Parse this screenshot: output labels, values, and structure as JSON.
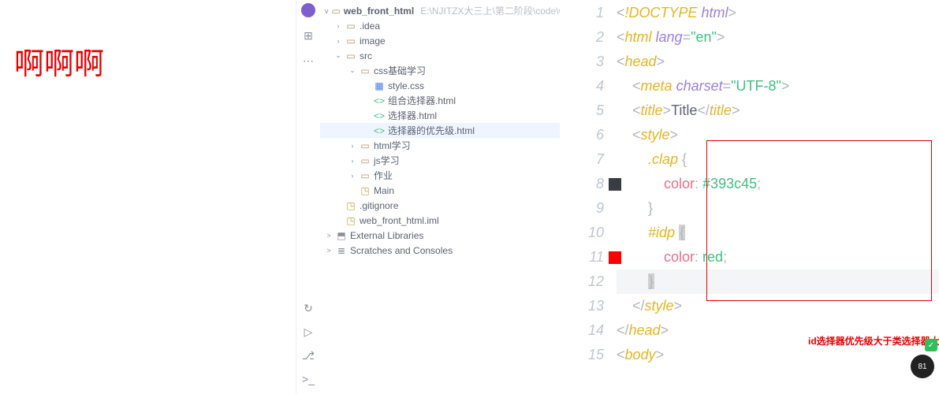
{
  "page_render": {
    "text": "啊啊啊"
  },
  "toolstrip": {
    "top": [
      "avatar",
      "structure-icon",
      "more-icon"
    ],
    "bottom": [
      "history-icon",
      "run-icon",
      "git-icon",
      "terminal-icon"
    ]
  },
  "project": {
    "root_name": "web_front_html",
    "root_path": "E:\\NJITZX大三上\\第二阶段\\code\\web_front_html",
    "items": [
      {
        "depth": 1,
        "chev": ">",
        "icon": "folder",
        "label": ".idea"
      },
      {
        "depth": 1,
        "chev": ">",
        "icon": "folder",
        "label": "image"
      },
      {
        "depth": 1,
        "chev": "v",
        "icon": "folder",
        "label": "src"
      },
      {
        "depth": 2,
        "chev": "v",
        "icon": "folder",
        "label": "css基础学习"
      },
      {
        "depth": 3,
        "chev": "",
        "icon": "css",
        "label": "style.css"
      },
      {
        "depth": 3,
        "chev": "",
        "icon": "html",
        "label": "组合选择器.html"
      },
      {
        "depth": 3,
        "chev": "",
        "icon": "html",
        "label": "选择器.html"
      },
      {
        "depth": 3,
        "chev": "",
        "icon": "html",
        "label": "选择器的优先级.html",
        "selected": true
      },
      {
        "depth": 2,
        "chev": ">",
        "icon": "folder",
        "label": "html学习"
      },
      {
        "depth": 2,
        "chev": ">",
        "icon": "folder",
        "label": "js学习"
      },
      {
        "depth": 2,
        "chev": ">",
        "icon": "folder",
        "label": "作业"
      },
      {
        "depth": 2,
        "chev": "",
        "icon": "cfg",
        "label": "Main"
      },
      {
        "depth": 1,
        "chev": "",
        "icon": "cfg",
        "label": ".gitignore"
      },
      {
        "depth": 1,
        "chev": "",
        "icon": "cfg",
        "label": "web_front_html.iml"
      }
    ],
    "ext_lib": "External Libraries",
    "scratches": "Scratches and Consoles"
  },
  "editor": {
    "lines": [
      {
        "n": 1,
        "tokens": [
          [
            "<",
            "angle"
          ],
          [
            "!DOCTYPE ",
            "tag"
          ],
          [
            "html",
            "attr"
          ],
          [
            ">",
            "angle"
          ]
        ]
      },
      {
        "n": 2,
        "tokens": [
          [
            "<",
            "angle"
          ],
          [
            "html ",
            "tag"
          ],
          [
            "lang",
            "attr"
          ],
          [
            "=",
            "eq"
          ],
          [
            "\"en\"",
            "str"
          ],
          [
            ">",
            "angle"
          ]
        ]
      },
      {
        "n": 3,
        "tokens": [
          [
            "<",
            "angle"
          ],
          [
            "head",
            "tag"
          ],
          [
            ">",
            "angle"
          ]
        ]
      },
      {
        "n": 4,
        "tokens": [
          [
            "    ",
            ""
          ],
          [
            "<",
            "angle"
          ],
          [
            "meta ",
            "tag"
          ],
          [
            "charset",
            "attr"
          ],
          [
            "=",
            "eq"
          ],
          [
            "\"UTF-8\"",
            "str"
          ],
          [
            ">",
            "angle"
          ]
        ]
      },
      {
        "n": 5,
        "tokens": [
          [
            "    ",
            ""
          ],
          [
            "<",
            "angle"
          ],
          [
            "title",
            "tag"
          ],
          [
            ">",
            "angle"
          ],
          [
            "Title",
            "txt"
          ],
          [
            "</",
            "angle"
          ],
          [
            "title",
            "tag"
          ],
          [
            ">",
            "angle"
          ]
        ]
      },
      {
        "n": 6,
        "tokens": [
          [
            "    ",
            ""
          ],
          [
            "<",
            "angle"
          ],
          [
            "style",
            "tag"
          ],
          [
            ">",
            "angle"
          ]
        ]
      },
      {
        "n": 7,
        "tokens": [
          [
            "        ",
            ""
          ],
          [
            ".clap ",
            "sel"
          ],
          [
            "{",
            "brace"
          ]
        ]
      },
      {
        "n": 8,
        "swatch": "dark",
        "tokens": [
          [
            "            ",
            ""
          ],
          [
            "color",
            "prop"
          ],
          [
            ": ",
            "brace"
          ],
          [
            "#393c45",
            "val"
          ],
          [
            ";",
            "brace"
          ]
        ]
      },
      {
        "n": 9,
        "tokens": [
          [
            "        ",
            ""
          ],
          [
            "}",
            "brace"
          ]
        ]
      },
      {
        "n": 10,
        "tokens": [
          [
            "        ",
            ""
          ],
          [
            "#idp ",
            "sel"
          ],
          [
            "{",
            "brace",
            "caret"
          ]
        ]
      },
      {
        "n": 11,
        "swatch": "red",
        "tokens": [
          [
            "            ",
            ""
          ],
          [
            "color",
            "prop"
          ],
          [
            ": ",
            "brace"
          ],
          [
            "red",
            "val"
          ],
          [
            ";",
            "brace"
          ]
        ]
      },
      {
        "n": 12,
        "hl": true,
        "tokens": [
          [
            "        ",
            ""
          ],
          [
            "}",
            "brace",
            "caret"
          ]
        ]
      },
      {
        "n": 13,
        "tokens": [
          [
            "    ",
            ""
          ],
          [
            "</",
            "angle"
          ],
          [
            "style",
            "tag"
          ],
          [
            ">",
            "angle"
          ]
        ]
      },
      {
        "n": 14,
        "tokens": [
          [
            "</",
            "angle"
          ],
          [
            "head",
            "tag"
          ],
          [
            ">",
            "angle"
          ]
        ]
      },
      {
        "n": 15,
        "tokens": [
          [
            "<",
            "angle"
          ],
          [
            "body",
            "tag"
          ],
          [
            ">",
            "angle"
          ]
        ]
      }
    ],
    "annotation": "id选择器优先级大于类选择器大于标签选择",
    "badge": "81"
  }
}
